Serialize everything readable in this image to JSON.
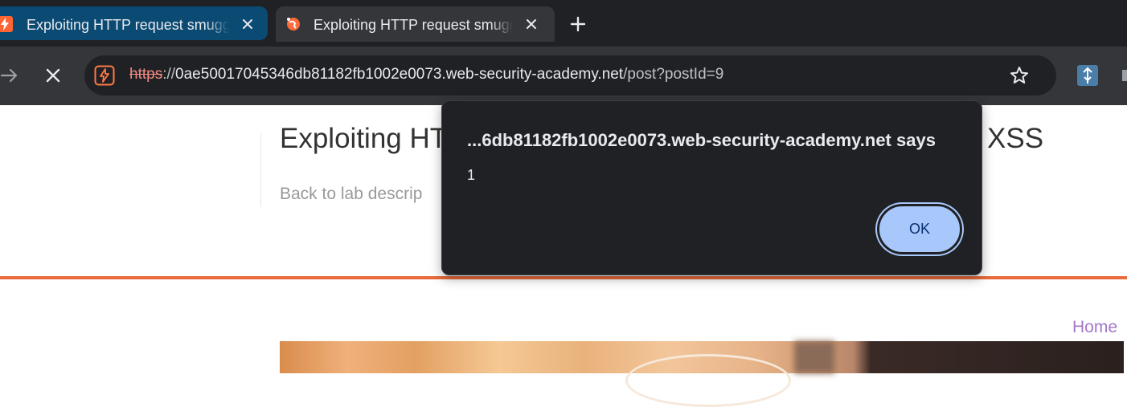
{
  "tabs": [
    {
      "title": "Exploiting HTTP request smuggling to deliver reflected XSS",
      "favicon": "lightning-favicon-icon",
      "active": false
    },
    {
      "title": "Exploiting HTTP request smuggling to deliver reflected XSS",
      "favicon": "globe-favicon-icon",
      "active": true
    }
  ],
  "toolbar": {
    "url_scheme": "https",
    "url_separator": "://",
    "url_host": "0ae50017045346db81182fb1002e0073.web-security-academy.net",
    "url_path": "/post?postId=9"
  },
  "page": {
    "title_start": "Exploiting HT",
    "title_end": "XSS",
    "back_link": "Back to lab descrip",
    "home_link": "Home"
  },
  "dialog": {
    "title": "...6db81182fb1002e0073.web-security-academy.net says",
    "message": "1",
    "ok_label": "OK"
  },
  "colors": {
    "accent_orange": "#e86b3c",
    "home_link": "#a476c9",
    "ok_button": "#a8c7fa"
  }
}
